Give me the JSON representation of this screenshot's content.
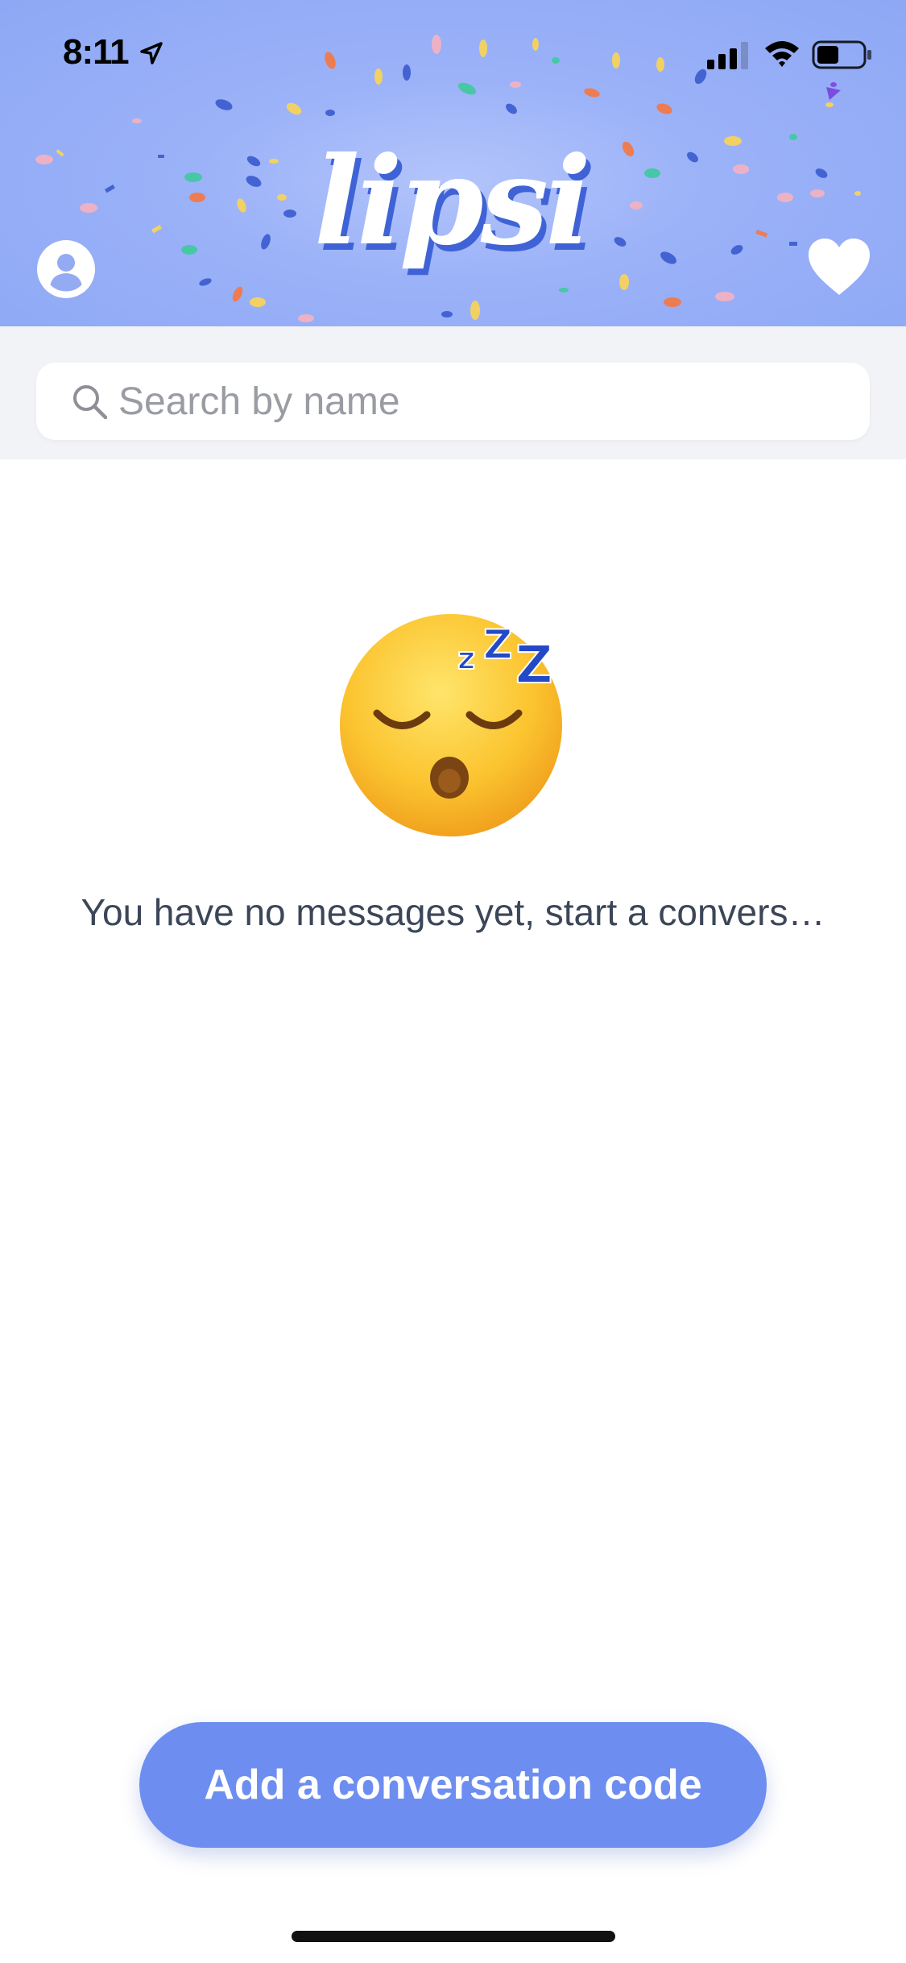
{
  "status_bar": {
    "time": "8:11",
    "icons": [
      "location-arrow-icon",
      "cellular-signal-icon",
      "wifi-icon",
      "battery-icon"
    ]
  },
  "header": {
    "logo_text": "lipsi",
    "background_color": "#93abf6",
    "logo_shadow_color": "#3f63d6",
    "left_icon": "profile-icon",
    "right_icon": "heart-icon"
  },
  "search": {
    "placeholder": "Search by name",
    "value": ""
  },
  "empty_state": {
    "icon": "sleeping-face-emoji",
    "message": "You have no messages yet, start a convers…"
  },
  "cta": {
    "label": "Add a conversation code",
    "color": "#6d8ef0"
  }
}
